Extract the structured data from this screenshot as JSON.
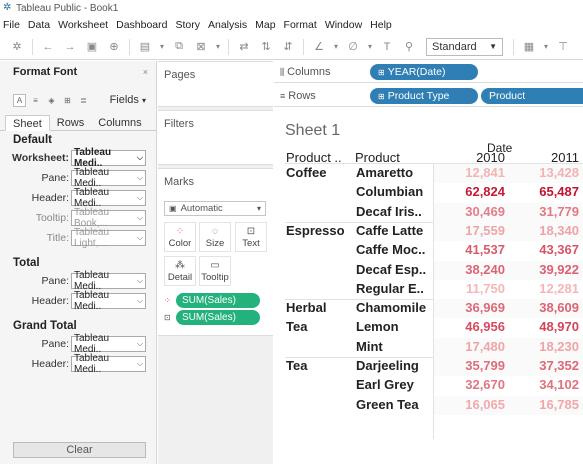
{
  "window": {
    "title": "Tableau Public - Book1"
  },
  "menu": [
    "File",
    "Data",
    "Worksheet",
    "Dashboard",
    "Story",
    "Analysis",
    "Map",
    "Format",
    "Window",
    "Help"
  ],
  "toolbar": {
    "fit_select": "Standard"
  },
  "format_pane": {
    "title": "Format Font",
    "fields_label": "Fields",
    "tabs": [
      "Sheet",
      "Rows",
      "Columns"
    ],
    "default_section": "Default",
    "default_rows": [
      {
        "label": "Worksheet:",
        "value": "Tableau Medi..",
        "dim": false
      },
      {
        "label": "Pane:",
        "value": "Tableau Medi..",
        "dim": false
      },
      {
        "label": "Header:",
        "value": "Tableau Medi..",
        "dim": false
      },
      {
        "label": "Tooltip:",
        "value": "Tableau Book,...",
        "dim": true
      },
      {
        "label": "Title:",
        "value": "Tableau Light,...",
        "dim": true
      }
    ],
    "total_section": "Total",
    "total_rows": [
      {
        "label": "Pane:",
        "value": "Tableau Medi.."
      },
      {
        "label": "Header:",
        "value": "Tableau Medi.."
      }
    ],
    "grand_total_section": "Grand Total",
    "grand_total_rows": [
      {
        "label": "Pane:",
        "value": "Tableau Medi.."
      },
      {
        "label": "Header:",
        "value": "Tableau Medi.."
      }
    ],
    "clear_label": "Clear"
  },
  "cards": {
    "pages": "Pages",
    "filters": "Filters",
    "marks": "Marks",
    "mark_type": "Automatic",
    "mark_buttons": [
      "Color",
      "Size",
      "Text",
      "Detail",
      "Tooltip"
    ],
    "mark_pills": [
      "SUM(Sales)",
      "SUM(Sales)"
    ]
  },
  "shelves": {
    "columns_label": "Columns",
    "columns_pill": "YEAR(Date)",
    "rows_label": "Rows",
    "rows_pills": [
      "Product Type",
      "Product"
    ]
  },
  "sheet": {
    "title": "Sheet 1",
    "col_header_1": "Product ..",
    "col_header_2": "Product",
    "date_header": "Date",
    "years": [
      "2010",
      "2011"
    ],
    "groups": [
      {
        "type": "Coffee",
        "type_line2": "",
        "rows": [
          {
            "product": "Amaretto",
            "v2010": "12,841",
            "v2011": "13,428"
          },
          {
            "product": "Columbian",
            "v2010": "62,824",
            "v2011": "65,487"
          },
          {
            "product": "Decaf Iris..",
            "v2010": "30,469",
            "v2011": "31,779"
          }
        ]
      },
      {
        "type": "Espresso",
        "type_line2": "",
        "rows": [
          {
            "product": "Caffe Latte",
            "v2010": "17,559",
            "v2011": "18,340"
          },
          {
            "product": "Caffe Moc..",
            "v2010": "41,537",
            "v2011": "43,367"
          },
          {
            "product": "Decaf Esp..",
            "v2010": "38,240",
            "v2011": "39,922"
          },
          {
            "product": "Regular E..",
            "v2010": "11,750",
            "v2011": "12,281"
          }
        ]
      },
      {
        "type": "Herbal",
        "type_line2": "Tea",
        "rows": [
          {
            "product": "Chamomile",
            "v2010": "36,969",
            "v2011": "38,609"
          },
          {
            "product": "Lemon",
            "v2010": "46,956",
            "v2011": "48,970"
          },
          {
            "product": "Mint",
            "v2010": "17,480",
            "v2011": "18,230"
          }
        ]
      },
      {
        "type": "Tea",
        "type_line2": "",
        "rows": [
          {
            "product": "Darjeeling",
            "v2010": "35,799",
            "v2011": "37,352"
          },
          {
            "product": "Earl Grey",
            "v2010": "32,670",
            "v2011": "34,102"
          },
          {
            "product": "Green Tea",
            "v2010": "16,065",
            "v2011": "16,785"
          }
        ]
      }
    ]
  }
}
